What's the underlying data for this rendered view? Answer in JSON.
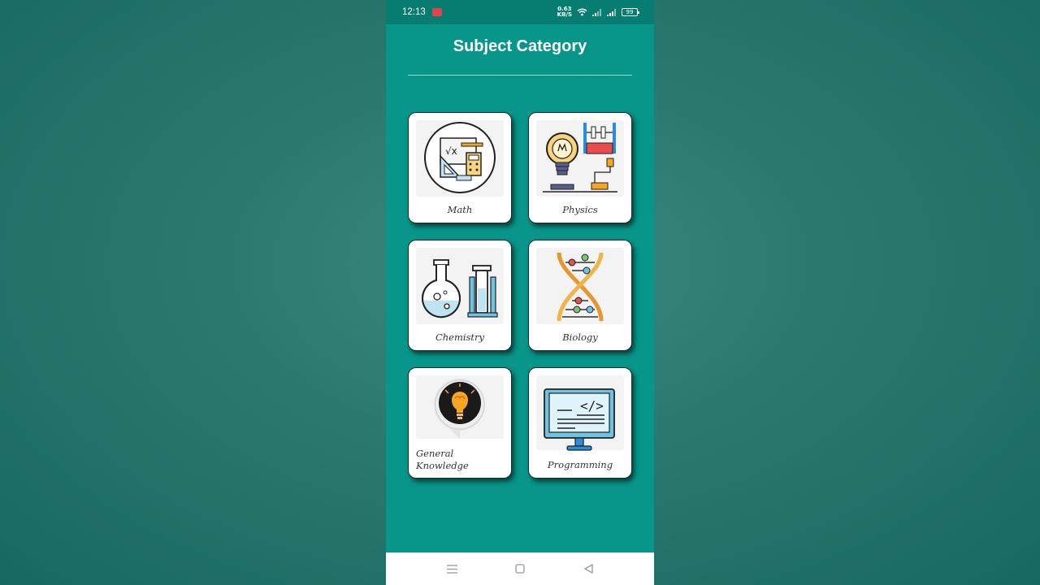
{
  "status": {
    "time": "12:13",
    "speed_value": "0.63",
    "speed_unit": "KB/S",
    "battery": "99"
  },
  "header": {
    "title": "Subject Category"
  },
  "categories": [
    {
      "label": "Math",
      "icon": "math-icon"
    },
    {
      "label": "Physics",
      "icon": "physics-icon"
    },
    {
      "label": "Chemistry",
      "icon": "chemistry-icon"
    },
    {
      "label": "Biology",
      "icon": "biology-icon"
    },
    {
      "label": "General Knowledge",
      "icon": "brain-bulb-icon"
    },
    {
      "label": "Programming",
      "icon": "code-monitor-icon"
    }
  ],
  "colors": {
    "primary": "#08968a",
    "status_bar": "#077d72",
    "card": "#ffffff"
  },
  "navbar": {
    "icons": [
      "menu-icon",
      "home-icon",
      "back-icon"
    ]
  }
}
